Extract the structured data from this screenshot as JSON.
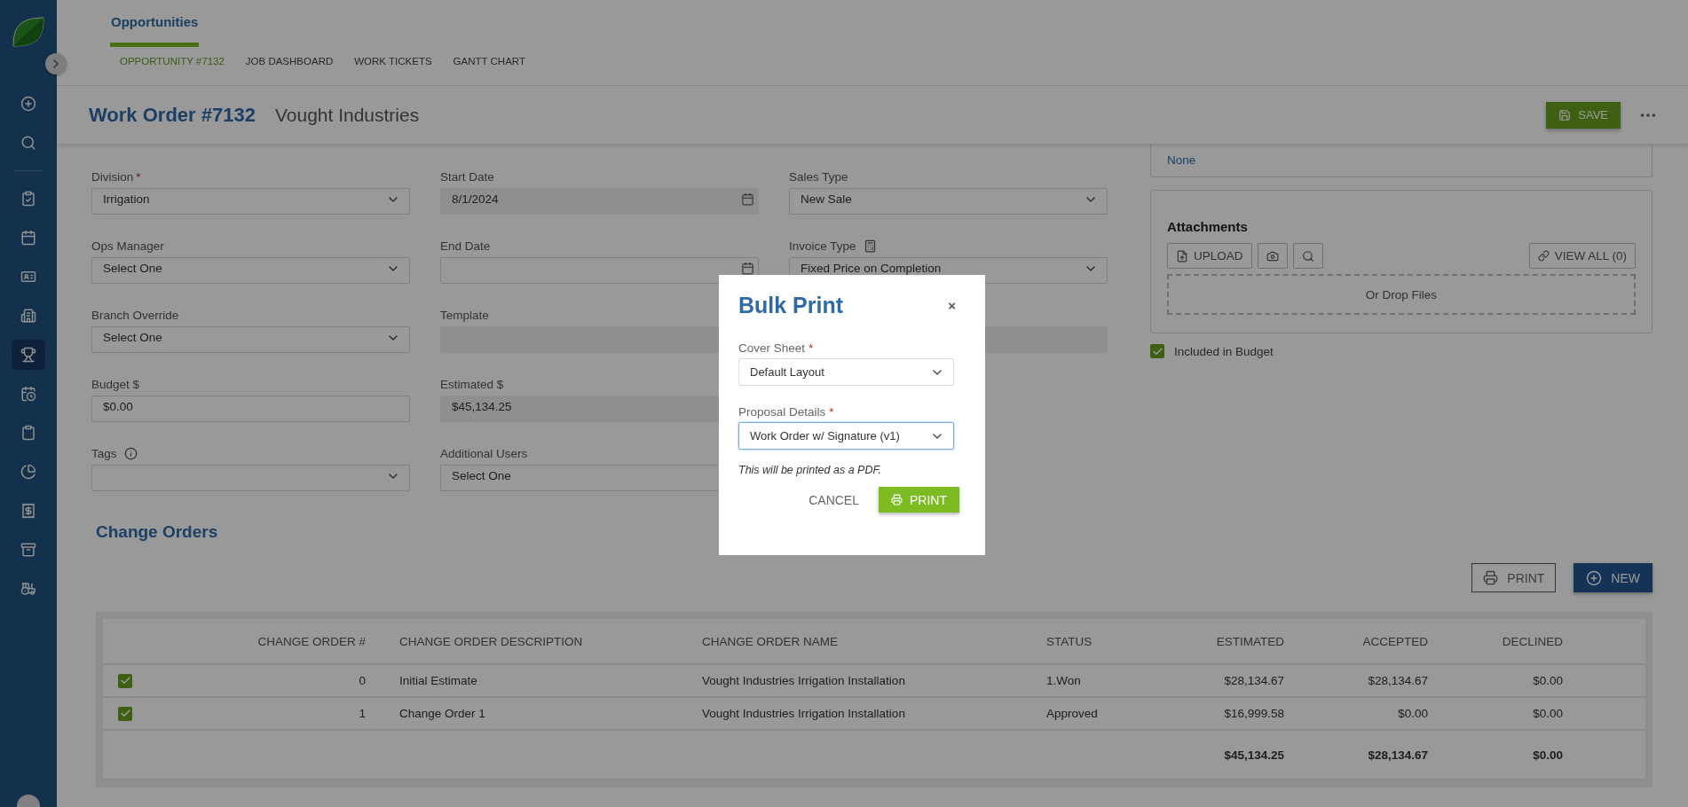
{
  "sidebar": {
    "items": [
      {
        "selected": false
      },
      {
        "selected": false
      },
      {
        "selected": false
      },
      {
        "selected": false
      },
      {
        "selected": false
      },
      {
        "selected": false
      },
      {
        "selected": true
      },
      {
        "selected": false
      },
      {
        "selected": false
      },
      {
        "selected": false
      },
      {
        "selected": false
      },
      {
        "selected": false
      },
      {
        "selected": false
      }
    ]
  },
  "nav": {
    "title": "Opportunities",
    "tabs": [
      {
        "label": "OPPORTUNITY #7132",
        "selected": true
      },
      {
        "label": "JOB DASHBOARD",
        "selected": false
      },
      {
        "label": "WORK TICKETS",
        "selected": false
      },
      {
        "label": "GANTT CHART",
        "selected": false
      }
    ]
  },
  "header": {
    "title": "Work Order #7132",
    "subtitle": "Vought Industries",
    "save": "SAVE"
  },
  "form": {
    "rows": [
      [
        {
          "label": "Division",
          "required_mark": "*",
          "kind": "select",
          "value": "Irrigation"
        },
        {
          "label": "Start Date",
          "kind": "date",
          "value": "8/1/2024",
          "disabled": true
        },
        {
          "label": "Sales Type",
          "kind": "select",
          "value": "New Sale"
        }
      ],
      [
        {
          "label": "Ops Manager",
          "kind": "select",
          "value": "Select One"
        },
        {
          "label": "End Date",
          "kind": "date",
          "disabled": false
        },
        {
          "label": "Invoice Type",
          "label_icon": true,
          "kind": "select",
          "value": "Fixed Price on Completion"
        }
      ],
      [
        {
          "label": "Branch Override",
          "kind": "select",
          "value": "Select One"
        },
        {
          "label": "Template",
          "kind": "text",
          "disabled": true
        },
        {
          "kind": "text",
          "disabled": true
        }
      ],
      [
        {
          "label": "Budget $",
          "kind": "text",
          "value": "$0.00",
          "disabled": false
        },
        {
          "label": "Estimated $",
          "kind": "text",
          "value": "$45,134.25",
          "disabled": true
        }
      ],
      [
        {
          "label": "Tags",
          "label_icon": true,
          "kind": "select"
        },
        {
          "label": "Additional Users",
          "kind": "select",
          "value": "Select One"
        }
      ]
    ]
  },
  "side": {
    "top_card": {
      "text": "None"
    },
    "attachments": {
      "title": "Attachments",
      "upload": "UPLOAD",
      "view_all": "VIEW ALL (0)",
      "drop": "Or Drop Files"
    },
    "included": {
      "label": "Included in Budget",
      "checked": true
    }
  },
  "change_orders": {
    "title": "Change Orders",
    "print": "PRINT",
    "new": "NEW",
    "columns": [
      "CHANGE ORDER #",
      "CHANGE ORDER DESCRIPTION",
      "CHANGE ORDER NAME",
      "STATUS",
      "ESTIMATED",
      "ACCEPTED",
      "DECLINED"
    ],
    "rows": [
      {
        "checked": true,
        "cells": [
          "0",
          "Initial Estimate",
          "Vought Industries Irrigation Installation",
          "1.Won",
          "$28,134.67",
          "$28,134.67",
          "$0.00"
        ]
      },
      {
        "checked": true,
        "cells": [
          "1",
          "Change Order 1",
          "Vought Industries Irrigation Installation",
          "Approved",
          "$16,999.58",
          "$0.00",
          "$0.00"
        ]
      }
    ],
    "totals": [
      "$45,134.25",
      "$28,134.67",
      "$0.00"
    ]
  },
  "modal": {
    "title": "Bulk Print",
    "close": "×",
    "fields": [
      {
        "label": "Cover Sheet",
        "required_mark": "*",
        "value": "Default Layout",
        "focused": false
      },
      {
        "label": "Proposal Details",
        "required_mark": "*",
        "value": "Work Order w/ Signature (v1)",
        "focused": true
      }
    ],
    "note": "This will be printed as a PDF.",
    "cancel": "CANCEL",
    "print": "PRINT"
  }
}
